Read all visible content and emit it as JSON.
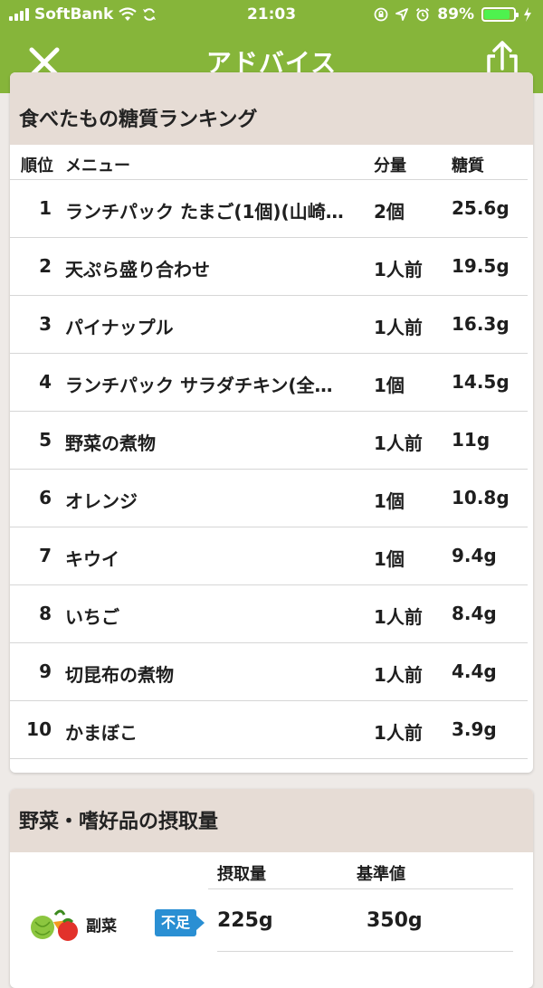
{
  "status": {
    "carrier": "SoftBank",
    "time": "21:03",
    "battery": "89%",
    "battery_level": 0.89
  },
  "nav": {
    "title": "アドバイス"
  },
  "ranking": {
    "title": "食べたもの糖質ランキング",
    "headers": {
      "rank": "順位",
      "menu": "メニュー",
      "amount": "分量",
      "carb": "糖質"
    },
    "rows": [
      {
        "rank": "1",
        "menu": "ランチパック たまご(1個)(山崎…",
        "amount": "2個",
        "carb": "25.6g"
      },
      {
        "rank": "2",
        "menu": "天ぷら盛り合わせ",
        "amount": "1人前",
        "carb": "19.5g"
      },
      {
        "rank": "3",
        "menu": "パイナップル",
        "amount": "1人前",
        "carb": "16.3g"
      },
      {
        "rank": "4",
        "menu": "ランチパック サラダチキン(全…",
        "amount": "1個",
        "carb": "14.5g"
      },
      {
        "rank": "5",
        "menu": "野菜の煮物",
        "amount": "1人前",
        "carb": "11g"
      },
      {
        "rank": "6",
        "menu": "オレンジ",
        "amount": "1個",
        "carb": "10.8g"
      },
      {
        "rank": "7",
        "menu": "キウイ",
        "amount": "1個",
        "carb": "9.4g"
      },
      {
        "rank": "8",
        "menu": "いちご",
        "amount": "1人前",
        "carb": "8.4g"
      },
      {
        "rank": "9",
        "menu": "切昆布の煮物",
        "amount": "1人前",
        "carb": "4.4g"
      },
      {
        "rank": "10",
        "menu": "かまぼこ",
        "amount": "1人前",
        "carb": "3.9g"
      }
    ]
  },
  "intake": {
    "title": "野菜・嗜好品の摂取量",
    "headers": {
      "amount": "摂取量",
      "standard": "基準値"
    },
    "items": [
      {
        "label": "副菜",
        "badge": "不足",
        "amount": "225g",
        "standard": "350g",
        "icon": "vegetables-icon"
      }
    ]
  },
  "colors": {
    "header_green": "#86b53a",
    "card_header": "#e6dcd5",
    "badge_blue": "#2a8fd3"
  }
}
